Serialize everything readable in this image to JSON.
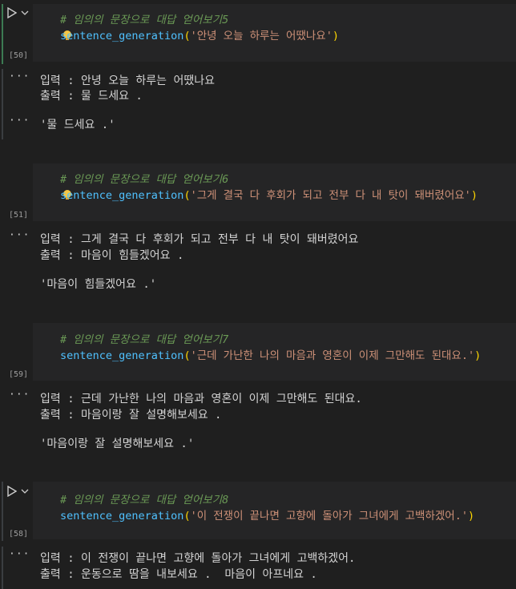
{
  "cells": [
    {
      "exec_count": "[50]",
      "comment": "# 임의의 문장으로 대답 얻어보기5",
      "fn": "sentence_generation",
      "arg": "'안녕 오늘 하루는 어땠나요'",
      "output": [
        "입력 : 안녕 오늘 하루는 어땠나요",
        "출력 : 물 드세요 .",
        "'물 드세요 .'"
      ]
    },
    {
      "exec_count": "[51]",
      "comment": "# 임의의 문장으로 대답 얻어보기6",
      "fn": "sentence_generation",
      "arg": "'그게 결국 다 후회가 되고 전부 다 내 탓이 돼버렸어요'",
      "output": [
        "입력 : 그게 결국 다 후회가 되고 전부 다 내 탓이 돼버렸어요",
        "출력 : 마음이 힘들겠어요 .",
        "'마음이 힘들겠어요 .'"
      ]
    },
    {
      "exec_count": "[59]",
      "comment": "# 임의의 문장으로 대답 얻어보기7",
      "fn": "sentence_generation",
      "arg": "'근데 가난한 나의 마음과 영혼이 이제 그만해도 된대요.'",
      "output": [
        "입력 : 근데 가난한 나의 마음과 영혼이 이제 그만해도 된대요.",
        "출력 : 마음이랑 잘 설명해보세요 .",
        "'마음이랑 잘 설명해보세요 .'"
      ]
    },
    {
      "exec_count": "[58]",
      "comment": "# 임의의 문장으로 대답 얻어보기8",
      "fn": "sentence_generation",
      "arg": "'이 전쟁이 끝나면 고향에 돌아가 그녀에게 고백하겠어.'",
      "output": [
        "입력 : 이 전쟁이 끝나면 고향에 돌아가 그녀에게 고백하겠어.",
        "출력 : 운동으로 땀을 내보세요 .  마음이 아프네요 ."
      ]
    }
  ],
  "output_marker": "···",
  "colors": {
    "background": "#1f1f1f",
    "code_bg": "#252526",
    "comment": "#6a9955",
    "function": "#4fc1ff",
    "string": "#ce9178",
    "paren": "#ffd700"
  }
}
